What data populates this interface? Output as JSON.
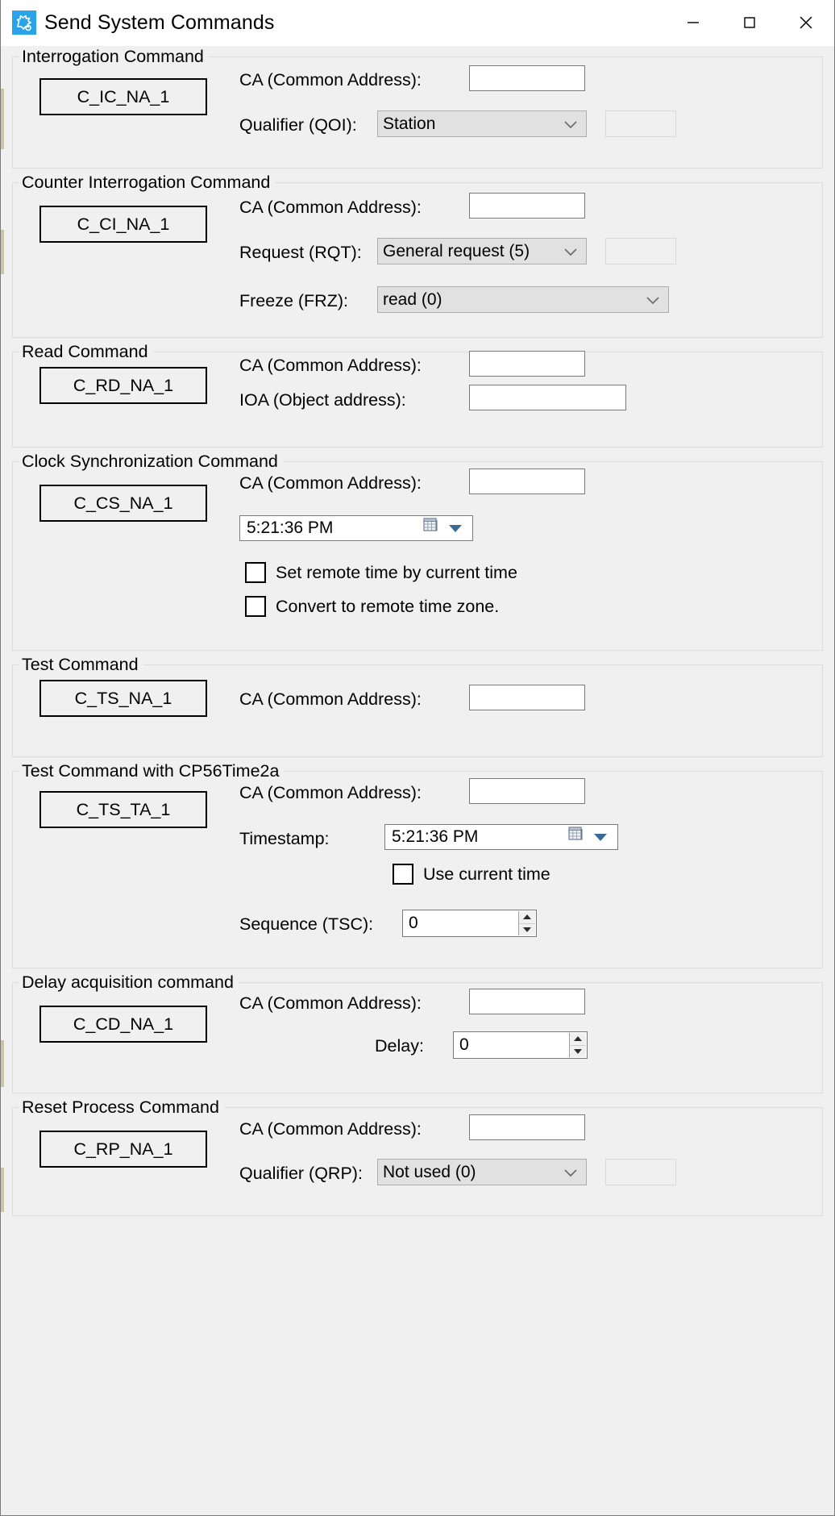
{
  "window": {
    "title": "Send System Commands",
    "icon": "app-gear-icon",
    "minimize_label": "Minimize",
    "maximize_label": "Maximize",
    "close_label": "Close"
  },
  "labels": {
    "ca": "CA (Common Address):",
    "ioa": "IOA (Object address):",
    "qualifier_qoi": "Qualifier (QOI):",
    "request_rqt": "Request (RQT):",
    "freeze_frz": "Freeze (FRZ):",
    "timestamp": "Timestamp:",
    "sequence_tsc": "Sequence (TSC):",
    "delay": "Delay:",
    "qualifier_qrp": "Qualifier (QRP):"
  },
  "groups": [
    {
      "title": "Interrogation Command",
      "button": "C_IC_NA_1",
      "ca_value": "",
      "qoi_value": "Station"
    },
    {
      "title": "Counter Interrogation Command",
      "button": "C_CI_NA_1",
      "ca_value": "",
      "rqt_value": "General request (5)",
      "frz_value": "read (0)"
    },
    {
      "title": "Read Command",
      "button": "C_RD_NA_1",
      "ca_value": "",
      "ioa_value": ""
    },
    {
      "title": "Clock Synchronization Command",
      "button": "C_CS_NA_1",
      "ca_value": "",
      "time_value": "5:21:36 PM",
      "chk_set_remote": "Set remote time by current time",
      "chk_convert_zone": "Convert to remote time zone."
    },
    {
      "title": "Test Command",
      "button": "C_TS_NA_1",
      "ca_value": ""
    },
    {
      "title": "Test Command with CP56Time2a",
      "button": "C_TS_TA_1",
      "ca_value": "",
      "timestamp_value": "5:21:36 PM",
      "chk_use_current": "Use current time",
      "tsc_value": "0"
    },
    {
      "title": "Delay acquisition command",
      "button": "C_CD_NA_1",
      "ca_value": "",
      "delay_value": "0"
    },
    {
      "title": "Reset Process Command",
      "button": "C_RP_NA_1",
      "ca_value": "",
      "qrp_value": "Not used (0)"
    }
  ],
  "colors": {
    "accent": "#2aa3e8",
    "window_bg": "#f0f0f0",
    "field_bg": "#ffffff",
    "combo_bg": "#e1e1e1"
  }
}
